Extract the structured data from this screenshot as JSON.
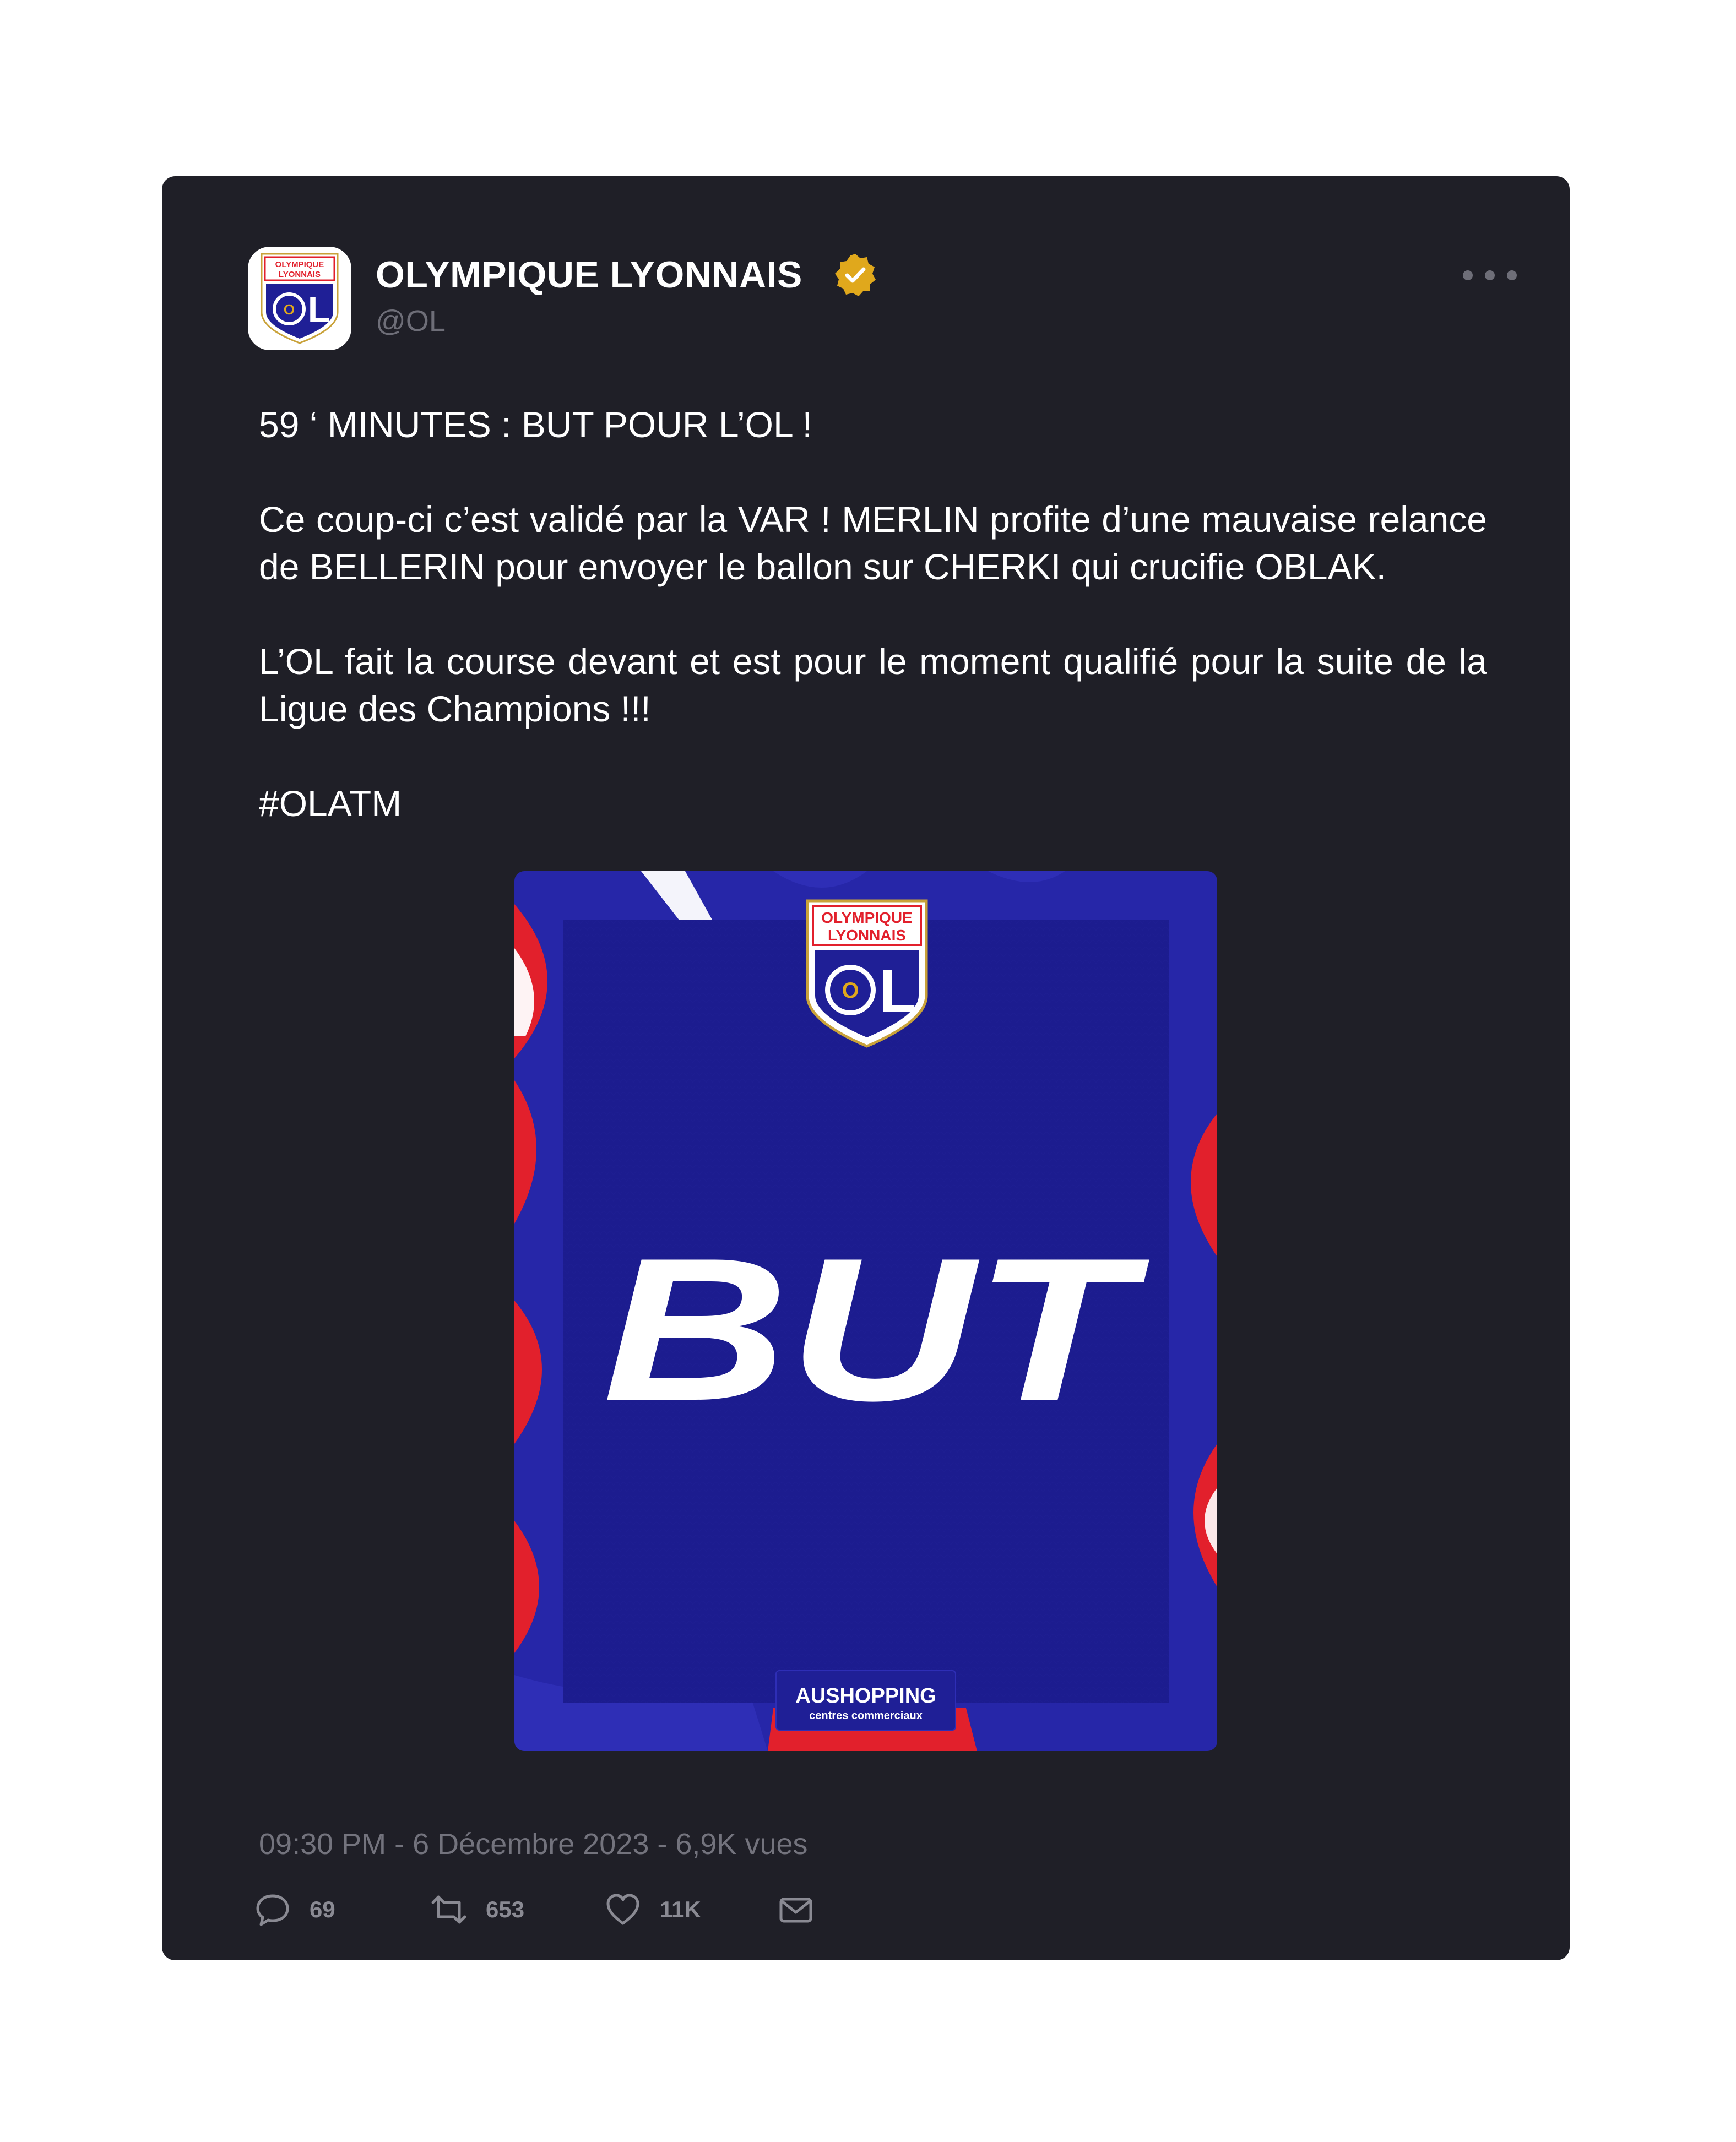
{
  "tweet": {
    "display_name": "OLYMPIQUE LYONNAIS",
    "handle": "@OL",
    "headline": "59 ‘ MINUTES : BUT POUR L’OL !",
    "paragraph_1": "Ce coup-ci c’est validé par la VAR ! MERLIN profite d’une mauvaise relance de BELLERIN pour envoyer le ballon sur CHERKI qui crucifie OBLAK.",
    "paragraph_2": "L’OL  fait la course devant et est pour le moment qualifié pour la suite de la Ligue des Champions !!!",
    "hashtag": "#OLATM",
    "meta": "09:30 PM  -  6 Décembre 2023 - 6,9K vues",
    "verified": true
  },
  "avatar_logo": {
    "line1": "OLYMPIQUE",
    "line2": "LYONNAIS",
    "letter_o": "O",
    "letter_l": "L"
  },
  "media": {
    "badge_line1": "OLYMPIQUE",
    "badge_line2": "LYONNAIS",
    "badge_o": "O",
    "badge_l": "L",
    "headline": "BUT",
    "sponsor_name": "AUSHOPPING",
    "sponsor_tagline": "centres commerciaux"
  },
  "actions": {
    "replies": "69",
    "retweets": "653",
    "likes": "11K"
  },
  "icons": {
    "verified": "verified-badge-icon",
    "more": "more-options-icon",
    "reply": "reply-icon",
    "retweet": "retweet-icon",
    "like": "heart-icon",
    "share": "mail-share-icon"
  },
  "colors": {
    "card_background": "#1f1f27",
    "ol_blue": "#1f1f96",
    "ol_red": "#e2202c",
    "verified_gold": "#e0a81c",
    "muted_text": "#73737d"
  }
}
